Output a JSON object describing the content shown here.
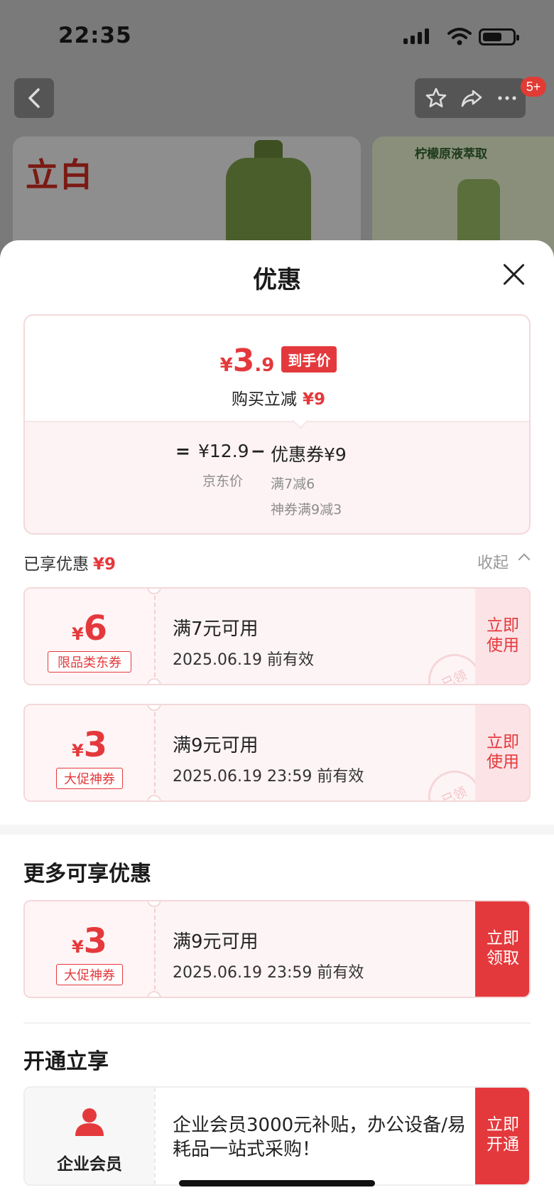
{
  "status_bar": {
    "time": "22:35"
  },
  "top_nav": {
    "badge": "5+"
  },
  "product": {
    "logo_text": "立白",
    "side_label": "柠檬原液萃取"
  },
  "sheet": {
    "title": "优惠"
  },
  "price_box": {
    "symbol": "¥",
    "price_int": "3",
    "price_dec": ".9",
    "tag": "到手价",
    "cut_label": "购买立减",
    "cut_amount": "¥9",
    "equals": "=",
    "jd_price": "¥12.9",
    "jd_label": "京东价",
    "minus": "−",
    "coupon_total": "优惠券¥9",
    "coupon_line1": "满7减6",
    "coupon_line2": "神券满9减3"
  },
  "enjoyed": {
    "label": "已享优惠",
    "amount": "¥9",
    "collapse": "收起"
  },
  "enjoyed_coupons": [
    {
      "symbol": "¥",
      "amount": "6",
      "type": "限品类东券",
      "condition": "满7元可用",
      "validity": "2025.06.19 前有效",
      "action": "立即使用",
      "stamp": "已领"
    },
    {
      "symbol": "¥",
      "amount": "3",
      "type": "大促神券",
      "condition": "满9元可用",
      "validity": "2025.06.19 23:59 前有效",
      "action": "立即使用",
      "stamp": "已领"
    }
  ],
  "more": {
    "title": "更多可享优惠",
    "coupon": {
      "symbol": "¥",
      "amount": "3",
      "type": "大促神券",
      "condition": "满9元可用",
      "validity": "2025.06.19 23:59 前有效",
      "action": "立即领取"
    }
  },
  "open": {
    "title": "开通立享",
    "member": {
      "label": "企业会员",
      "description": "企业会员3000元补贴，办公设备/易耗品一站式采购！",
      "action": "立即开通"
    }
  },
  "colors": {
    "accent": "#e4393c",
    "coupon_bg": "#fdf4f5"
  },
  "icons": [
    "back-icon",
    "star-icon",
    "share-icon",
    "more-icon",
    "close-icon",
    "chevron-up-icon",
    "person-icon"
  ]
}
